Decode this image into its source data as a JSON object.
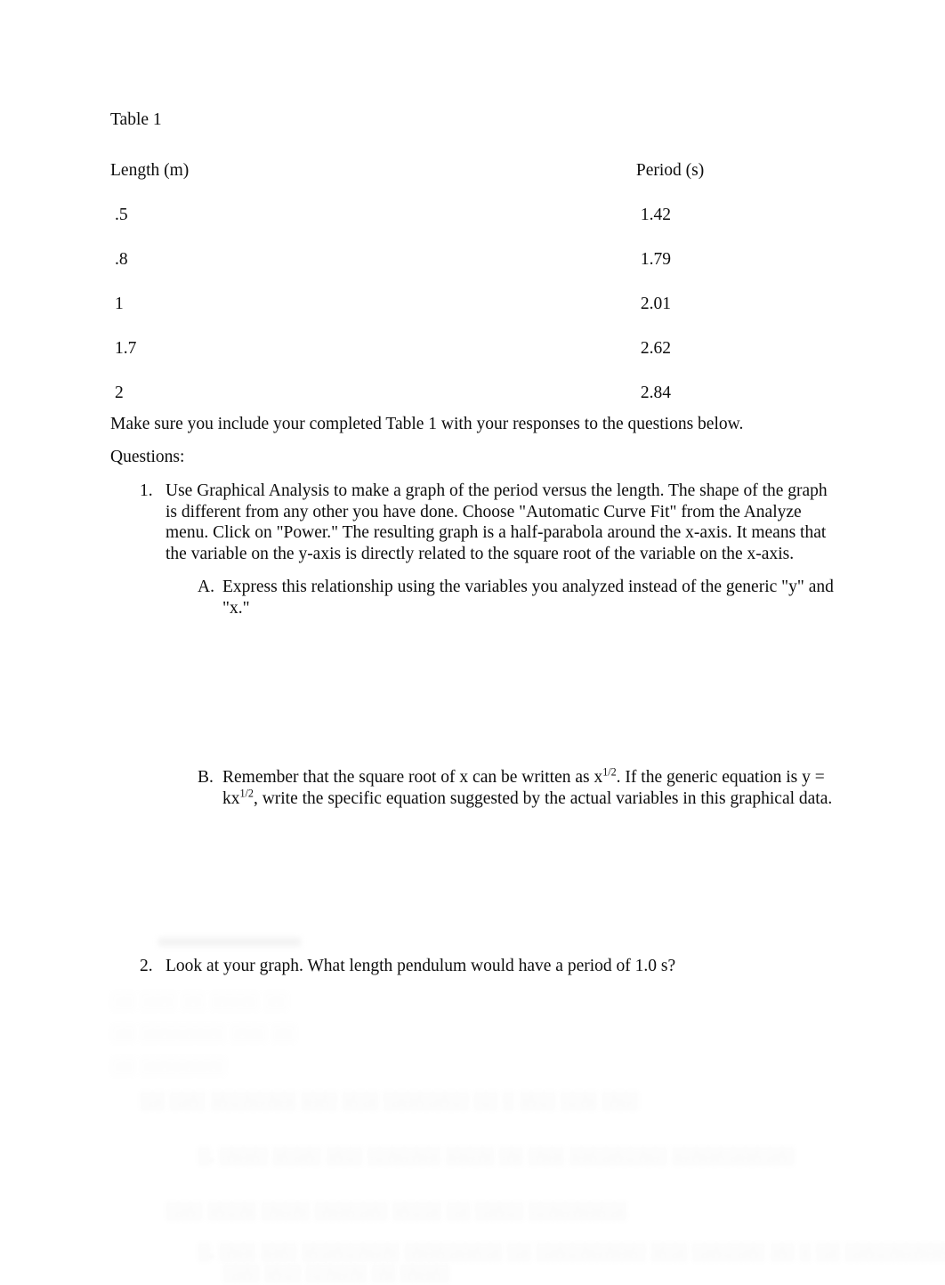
{
  "document": {
    "table_title": "Table 1",
    "table": {
      "columns": [
        "Length (m)",
        "Period (s)"
      ],
      "rows": [
        {
          "length": ".5",
          "period": "1.42"
        },
        {
          "length": ".8",
          "period": "1.79"
        },
        {
          "length": "1",
          "period": "2.01"
        },
        {
          "length": "1.7",
          "period": "2.62"
        },
        {
          "length": "2",
          "period": "2.84"
        }
      ]
    },
    "note": "Make sure you include your completed Table 1 with your responses to the questions below.",
    "questions_heading": "Questions:",
    "questions": [
      {
        "marker": "1.",
        "text": "Use Graphical Analysis to make a graph of the period versus the length. The shape of the graph is different from any other you have done. Choose \"Automatic Curve Fit\" from the Analyze menu. Click on \"Power.\" The resulting graph is a half-parabola around the x-axis. It means that the variable on the y-axis is directly related to the square root of the variable on the x-axis.",
        "sub_items": [
          {
            "marker": "A.",
            "text": "Express this relationship using the variables you analyzed instead of the generic \"y\" and \"x.\""
          },
          {
            "marker": "B.",
            "text_part1": "Remember that the square root of x can be written as x",
            "sup1": "1/2",
            "text_part2": ". If the generic equation is y = k",
            "text_part3": "x",
            "sup2": "1/2",
            "text_part4": ", write the specific equation suggested by the actual variables in this graphical data."
          }
        ]
      },
      {
        "marker": "2.",
        "text": "Look at your graph. What length pendulum would have a period of 1.0 s?"
      }
    ],
    "faded_artifacts": {
      "description": "illegible faded bleed-through text at page bottom",
      "lines": [
        "░░ ░░░ ░░ ░░░░ ░░",
        "░░ ░░░░░░░ ░░░ ░░",
        "░░ ░░░░░░░",
        "░░  ░░░ ░░░░░░░ ░░░ ░░░ ░░░░░░░ ░░ ░ ░░░ ░░░ ░░░",
        "░.  ░░░░ ░░░░ ░░░ ░░░░░░ ░░░░ ░░ ░░░ ░░░░░░░░ ░░░░░░░░░░",
        "░░░ ░░░░ ░░░░ ░░░░░░ ░░░░ ░░ ░░░░ ░░░░░░░░",
        "░.  ░░░ ░░░ ░░░░░░░░ ░░░░░░░░ ░░ ░░░░░░░░░ ░░░ ░░░░░░ ░░ ░ ░░ ░░░░░░░░░ ░░░░░░░░░ ░░░░",
        "░░░ ░░░ ░░░░░ ░░ ░░░░"
      ]
    }
  }
}
